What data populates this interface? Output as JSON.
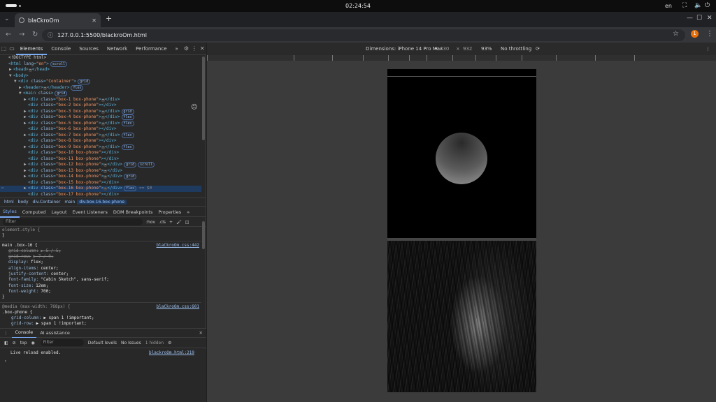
{
  "os": {
    "clock": "02:24:54",
    "language": "en"
  },
  "browser": {
    "tab_title": "blaCkroOm",
    "url": "127.0.0.1:5500/blackroOm.html",
    "profile_initial": "1"
  },
  "devtools": {
    "tabs": [
      "Elements",
      "Console",
      "Sources",
      "Network",
      "Performance"
    ],
    "more_tabs": "»",
    "dom": [
      {
        "indent": 0,
        "arrow": "",
        "parts": [
          {
            "c": "txt",
            "t": "<!DOCTYPE html>"
          }
        ]
      },
      {
        "indent": 0,
        "arrow": "",
        "parts": [
          {
            "c": "tag",
            "t": "<html "
          },
          {
            "c": "attr",
            "t": "lang"
          },
          {
            "c": "tag",
            "t": "="
          },
          {
            "c": "val",
            "t": "\"en\""
          },
          {
            "c": "tag",
            "t": ">"
          }
        ],
        "badges": [
          "scroll"
        ]
      },
      {
        "indent": 1,
        "arrow": "▶",
        "parts": [
          {
            "c": "tag",
            "t": "<head>"
          },
          {
            "c": "ell",
            "t": "⋯"
          },
          {
            "c": "tag",
            "t": "</head>"
          }
        ]
      },
      {
        "indent": 1,
        "arrow": "▼",
        "parts": [
          {
            "c": "tag",
            "t": "<body>"
          }
        ]
      },
      {
        "indent": 2,
        "arrow": "▼",
        "parts": [
          {
            "c": "tag",
            "t": "<div "
          },
          {
            "c": "attr",
            "t": "class"
          },
          {
            "c": "tag",
            "t": "="
          },
          {
            "c": "val",
            "t": "\"Container\""
          },
          {
            "c": "tag",
            "t": ">"
          }
        ],
        "badges": [
          "grid"
        ]
      },
      {
        "indent": 3,
        "arrow": "▶",
        "parts": [
          {
            "c": "tag",
            "t": "<header>"
          },
          {
            "c": "ell",
            "t": "⋯"
          },
          {
            "c": "tag",
            "t": "</header>"
          }
        ],
        "badges": [
          "flex"
        ]
      },
      {
        "indent": 3,
        "arrow": "▼",
        "parts": [
          {
            "c": "tag",
            "t": "<main "
          },
          {
            "c": "attr",
            "t": "class"
          },
          {
            "c": "tag",
            "t": ">"
          }
        ],
        "badges": [
          "grid"
        ]
      },
      {
        "indent": 4,
        "arrow": "▶",
        "parts": [
          {
            "c": "tag",
            "t": "<div "
          },
          {
            "c": "attr",
            "t": "class"
          },
          {
            "c": "tag",
            "t": "="
          },
          {
            "c": "val",
            "t": "\"box-1 box-phone\""
          },
          {
            "c": "tag",
            "t": ">"
          },
          {
            "c": "ell",
            "t": "⋯"
          },
          {
            "c": "tag",
            "t": "</div>"
          }
        ]
      },
      {
        "indent": 4,
        "arrow": "",
        "parts": [
          {
            "c": "tag",
            "t": "<div "
          },
          {
            "c": "attr",
            "t": "class"
          },
          {
            "c": "tag",
            "t": "="
          },
          {
            "c": "val",
            "t": "\"box-2 box-phone\""
          },
          {
            "c": "tag",
            "t": "></div>"
          }
        ]
      },
      {
        "indent": 4,
        "arrow": "▶",
        "parts": [
          {
            "c": "tag",
            "t": "<div "
          },
          {
            "c": "attr",
            "t": "class"
          },
          {
            "c": "tag",
            "t": "="
          },
          {
            "c": "val",
            "t": "\"box-3 box-phone\""
          },
          {
            "c": "tag",
            "t": ">"
          },
          {
            "c": "ell",
            "t": "⋯"
          },
          {
            "c": "tag",
            "t": "</div>"
          }
        ],
        "badges": [
          "grid"
        ]
      },
      {
        "indent": 4,
        "arrow": "▶",
        "parts": [
          {
            "c": "tag",
            "t": "<div "
          },
          {
            "c": "attr",
            "t": "class"
          },
          {
            "c": "tag",
            "t": "="
          },
          {
            "c": "val",
            "t": "\"box-4 box-phone\""
          },
          {
            "c": "tag",
            "t": ">"
          },
          {
            "c": "ell",
            "t": "⋯"
          },
          {
            "c": "tag",
            "t": "</div>"
          }
        ],
        "badges": [
          "flex"
        ]
      },
      {
        "indent": 4,
        "arrow": "▶",
        "parts": [
          {
            "c": "tag",
            "t": "<div "
          },
          {
            "c": "attr",
            "t": "class"
          },
          {
            "c": "tag",
            "t": "="
          },
          {
            "c": "val",
            "t": "\"box-5 box-phone\""
          },
          {
            "c": "tag",
            "t": ">"
          },
          {
            "c": "ell",
            "t": "⋯"
          },
          {
            "c": "tag",
            "t": "</div>"
          }
        ],
        "badges": [
          "flex"
        ]
      },
      {
        "indent": 4,
        "arrow": "",
        "parts": [
          {
            "c": "tag",
            "t": "<div "
          },
          {
            "c": "attr",
            "t": "class"
          },
          {
            "c": "tag",
            "t": "="
          },
          {
            "c": "val",
            "t": "\"box-6 box-phone\""
          },
          {
            "c": "tag",
            "t": "></div>"
          }
        ]
      },
      {
        "indent": 4,
        "arrow": "▶",
        "parts": [
          {
            "c": "tag",
            "t": "<div "
          },
          {
            "c": "attr",
            "t": "class"
          },
          {
            "c": "tag",
            "t": "="
          },
          {
            "c": "val",
            "t": "\"box-7 box-phone\""
          },
          {
            "c": "tag",
            "t": ">"
          },
          {
            "c": "ell",
            "t": "⋯"
          },
          {
            "c": "tag",
            "t": "</div>"
          }
        ],
        "badges": [
          "flex"
        ]
      },
      {
        "indent": 4,
        "arrow": "",
        "parts": [
          {
            "c": "tag",
            "t": "<div "
          },
          {
            "c": "attr",
            "t": "class"
          },
          {
            "c": "tag",
            "t": "="
          },
          {
            "c": "val",
            "t": "\"box-8 box-phone\""
          },
          {
            "c": "tag",
            "t": "></div>"
          }
        ]
      },
      {
        "indent": 4,
        "arrow": "▶",
        "parts": [
          {
            "c": "tag",
            "t": "<div "
          },
          {
            "c": "attr",
            "t": "class"
          },
          {
            "c": "tag",
            "t": "="
          },
          {
            "c": "val",
            "t": "\"box-9 box-phone\""
          },
          {
            "c": "tag",
            "t": ">"
          },
          {
            "c": "ell",
            "t": "⋯"
          },
          {
            "c": "tag",
            "t": "</div>"
          }
        ],
        "badges": [
          "flex"
        ]
      },
      {
        "indent": 4,
        "arrow": "",
        "parts": [
          {
            "c": "tag",
            "t": "<div "
          },
          {
            "c": "attr",
            "t": "class"
          },
          {
            "c": "tag",
            "t": "="
          },
          {
            "c": "val",
            "t": "\"box-10 box-phone\""
          },
          {
            "c": "tag",
            "t": "></div>"
          }
        ]
      },
      {
        "indent": 4,
        "arrow": "",
        "parts": [
          {
            "c": "tag",
            "t": "<div "
          },
          {
            "c": "attr",
            "t": "class"
          },
          {
            "c": "tag",
            "t": "="
          },
          {
            "c": "val",
            "t": "\"box-11 box-phone\""
          },
          {
            "c": "tag",
            "t": "></div>"
          }
        ]
      },
      {
        "indent": 4,
        "arrow": "▶",
        "parts": [
          {
            "c": "tag",
            "t": "<div "
          },
          {
            "c": "attr",
            "t": "class"
          },
          {
            "c": "tag",
            "t": "="
          },
          {
            "c": "val",
            "t": "\"box-12 box-phone\""
          },
          {
            "c": "tag",
            "t": ">"
          },
          {
            "c": "ell",
            "t": "⋯"
          },
          {
            "c": "tag",
            "t": "</div>"
          }
        ],
        "badges": [
          "grid",
          "scroll"
        ]
      },
      {
        "indent": 4,
        "arrow": "▶",
        "parts": [
          {
            "c": "tag",
            "t": "<div "
          },
          {
            "c": "attr",
            "t": "class"
          },
          {
            "c": "tag",
            "t": "="
          },
          {
            "c": "val",
            "t": "\"box-13 box-phone\""
          },
          {
            "c": "tag",
            "t": ">"
          },
          {
            "c": "ell",
            "t": "⋯"
          },
          {
            "c": "tag",
            "t": "</div>"
          }
        ]
      },
      {
        "indent": 4,
        "arrow": "▶",
        "parts": [
          {
            "c": "tag",
            "t": "<div "
          },
          {
            "c": "attr",
            "t": "class"
          },
          {
            "c": "tag",
            "t": "="
          },
          {
            "c": "val",
            "t": "\"box-14 box-phone\""
          },
          {
            "c": "tag",
            "t": ">"
          },
          {
            "c": "ell",
            "t": "⋯"
          },
          {
            "c": "tag",
            "t": "</div>"
          }
        ],
        "badges": [
          "grid"
        ]
      },
      {
        "indent": 4,
        "arrow": "",
        "parts": [
          {
            "c": "tag",
            "t": "<div "
          },
          {
            "c": "attr",
            "t": "class"
          },
          {
            "c": "tag",
            "t": "="
          },
          {
            "c": "val",
            "t": "\"box-15 box-phone\""
          },
          {
            "c": "tag",
            "t": "></div>"
          }
        ]
      },
      {
        "indent": 4,
        "arrow": "▶",
        "sel": true,
        "parts": [
          {
            "c": "tag",
            "t": "<div "
          },
          {
            "c": "attr",
            "t": "class"
          },
          {
            "c": "tag",
            "t": "="
          },
          {
            "c": "val",
            "t": "\"box-16 box-phone\""
          },
          {
            "c": "tag",
            "t": ">"
          },
          {
            "c": "ell",
            "t": "⋯"
          },
          {
            "c": "tag",
            "t": "</div>"
          }
        ],
        "badges": [
          "flex"
        ],
        "suffix": "== $0"
      },
      {
        "indent": 4,
        "arrow": "",
        "parts": [
          {
            "c": "tag",
            "t": "<div "
          },
          {
            "c": "attr",
            "t": "class"
          },
          {
            "c": "tag",
            "t": "="
          },
          {
            "c": "val",
            "t": "\"box-17 box-phone\""
          },
          {
            "c": "tag",
            "t": "></div>"
          }
        ]
      }
    ],
    "breadcrumbs": [
      "html",
      "body",
      "div.Container",
      "main",
      "div.box-16.box-phone"
    ],
    "subtabs": [
      "Styles",
      "Computed",
      "Layout",
      "Event Listeners",
      "DOM Breakpoints",
      "Properties"
    ],
    "styles_filter_placeholder": "Filter",
    "hov": ":hov",
    "cls": ".cls",
    "styles": {
      "element_style": "element.style {",
      "close": "}",
      "rule1_selector": "main .box-16 {",
      "rule1_source": "blaCkroOm.css:442",
      "rule1_props": [
        {
          "p": "grid-column:",
          "v": "▶ 5 / 5;",
          "strike": true
        },
        {
          "p": "grid-row:",
          "v": "▶ 7 / 9;",
          "strike": true
        },
        {
          "p": "display:",
          "v": "flex;",
          "strike": false
        },
        {
          "p": "align-items:",
          "v": "center;",
          "strike": false
        },
        {
          "p": "justify-content:",
          "v": "center;",
          "strike": false
        },
        {
          "p": "font-family:",
          "v": "\"Cabin Sketch\", sans-serif;",
          "strike": false
        },
        {
          "p": "font-size:",
          "v": "12em;",
          "strike": false
        },
        {
          "p": "font-weight:",
          "v": "700;",
          "strike": false
        }
      ],
      "media": "@media (max-width: 768px) {",
      "rule2_selector": ".box-phone {",
      "rule2_source": "blaCkroOm.css:601",
      "rule2_props": [
        {
          "p": "grid-column:",
          "v": "▶ span 1 !important;"
        },
        {
          "p": "grid-row:",
          "v": "▶ span 1 !important;"
        }
      ]
    },
    "console": {
      "tabs": [
        "Console",
        "AI assistance"
      ],
      "context": "top",
      "filter_placeholder": "Filter",
      "levels": "Default levels",
      "issues": "No Issues",
      "hidden": "1 hidden",
      "message": "Live reload enabled.",
      "message_source": "blackroOm.html:219",
      "prompt": "›"
    }
  },
  "device_toolbar": {
    "dimensions_label": "Dimensions: iPhone 14 Pro Max",
    "width": "430",
    "times": "×",
    "height": "932",
    "zoom": "93%",
    "throttling": "No throttling"
  }
}
